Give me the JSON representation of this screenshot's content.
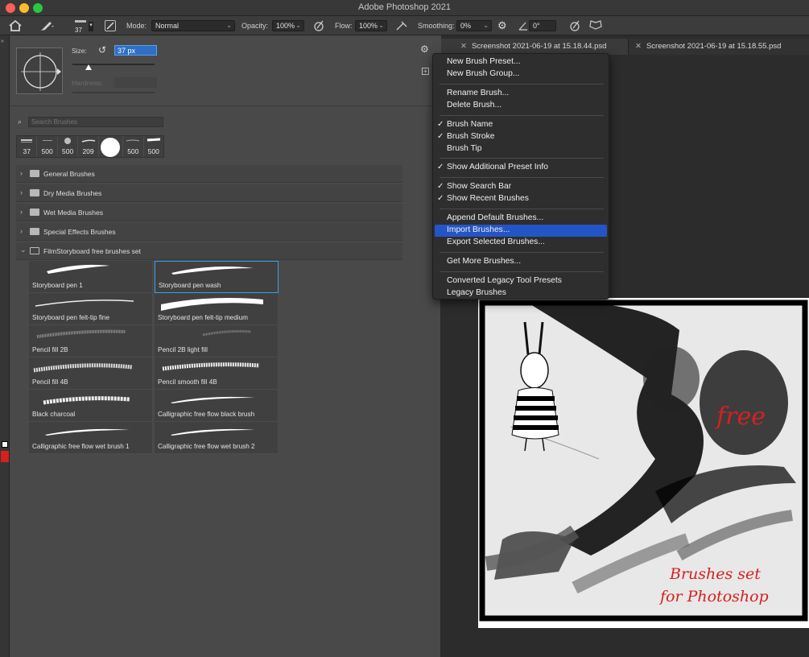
{
  "app": {
    "title": "Adobe Photoshop 2021"
  },
  "options_bar": {
    "brush_size": "37",
    "mode_label": "Mode:",
    "mode_value": "Normal",
    "opacity_label": "Opacity:",
    "opacity_value": "100%",
    "flow_label": "Flow:",
    "flow_value": "100%",
    "smoothing_label": "Smoothing:",
    "smoothing_value": "0%",
    "angle_value": "0°"
  },
  "brush_panel": {
    "size_label": "Size:",
    "size_value": "37 px",
    "hardness_label": "Hardness:",
    "search_placeholder": "Search Brushes",
    "recent_brushes": [
      "37",
      "500",
      "500",
      "209",
      "",
      "500",
      "500"
    ],
    "groups": [
      {
        "label": "General Brushes",
        "expanded": false
      },
      {
        "label": "Dry Media Brushes",
        "expanded": false
      },
      {
        "label": "Wet Media Brushes",
        "expanded": false
      },
      {
        "label": "Special Effects Brushes",
        "expanded": false
      },
      {
        "label": "FilmStoryboard free brushes set",
        "expanded": true
      }
    ],
    "brushes": [
      "Storyboard pen 1",
      "Storyboard pen wash",
      "Storyboard pen felt-tip fine",
      "Storyboard pen felt-tip medium",
      "Pencil fill 2B",
      "Pencil 2B light fill",
      "Pencil fill 4B",
      "Pencil smooth fill 4B",
      "Black charcoal",
      "Calligraphic free flow black brush",
      "Calligraphic free flow wet brush 1",
      "Calligraphic free flow wet brush 2"
    ],
    "selected_brush": "Storyboard pen wash"
  },
  "tabs": [
    {
      "label": "Screenshot 2021-06-19 at 15.18.44.psd"
    },
    {
      "label": "Screenshot 2021-06-19 at 15.18.55.psd"
    }
  ],
  "menu": {
    "items": [
      {
        "label": "New Brush Preset...",
        "checked": false
      },
      {
        "label": "New Brush Group...",
        "checked": false
      },
      {
        "label": "Rename Brush...",
        "checked": false
      },
      {
        "label": "Delete Brush...",
        "checked": false
      },
      {
        "label": "Brush Name",
        "checked": true
      },
      {
        "label": "Brush Stroke",
        "checked": true
      },
      {
        "label": "Brush Tip",
        "checked": false
      },
      {
        "label": "Show Additional Preset Info",
        "checked": true
      },
      {
        "label": "Show Search Bar",
        "checked": true
      },
      {
        "label": "Show Recent Brushes",
        "checked": true
      },
      {
        "label": "Append Default Brushes...",
        "checked": false
      },
      {
        "label": "Import Brushes...",
        "checked": false,
        "highlighted": true
      },
      {
        "label": "Export Selected Brushes...",
        "checked": false
      },
      {
        "label": "Get More Brushes...",
        "checked": false
      },
      {
        "label": "Converted Legacy Tool Presets",
        "checked": false
      },
      {
        "label": "Legacy Brushes",
        "checked": false
      }
    ]
  },
  "canvas": {
    "text_free": "free",
    "text_line1": "Brushes set",
    "text_line2": "for Photoshop"
  },
  "colors": {
    "accent": "#2455c6",
    "selection": "#3aa0e6",
    "canvas_red": "#d62020"
  }
}
